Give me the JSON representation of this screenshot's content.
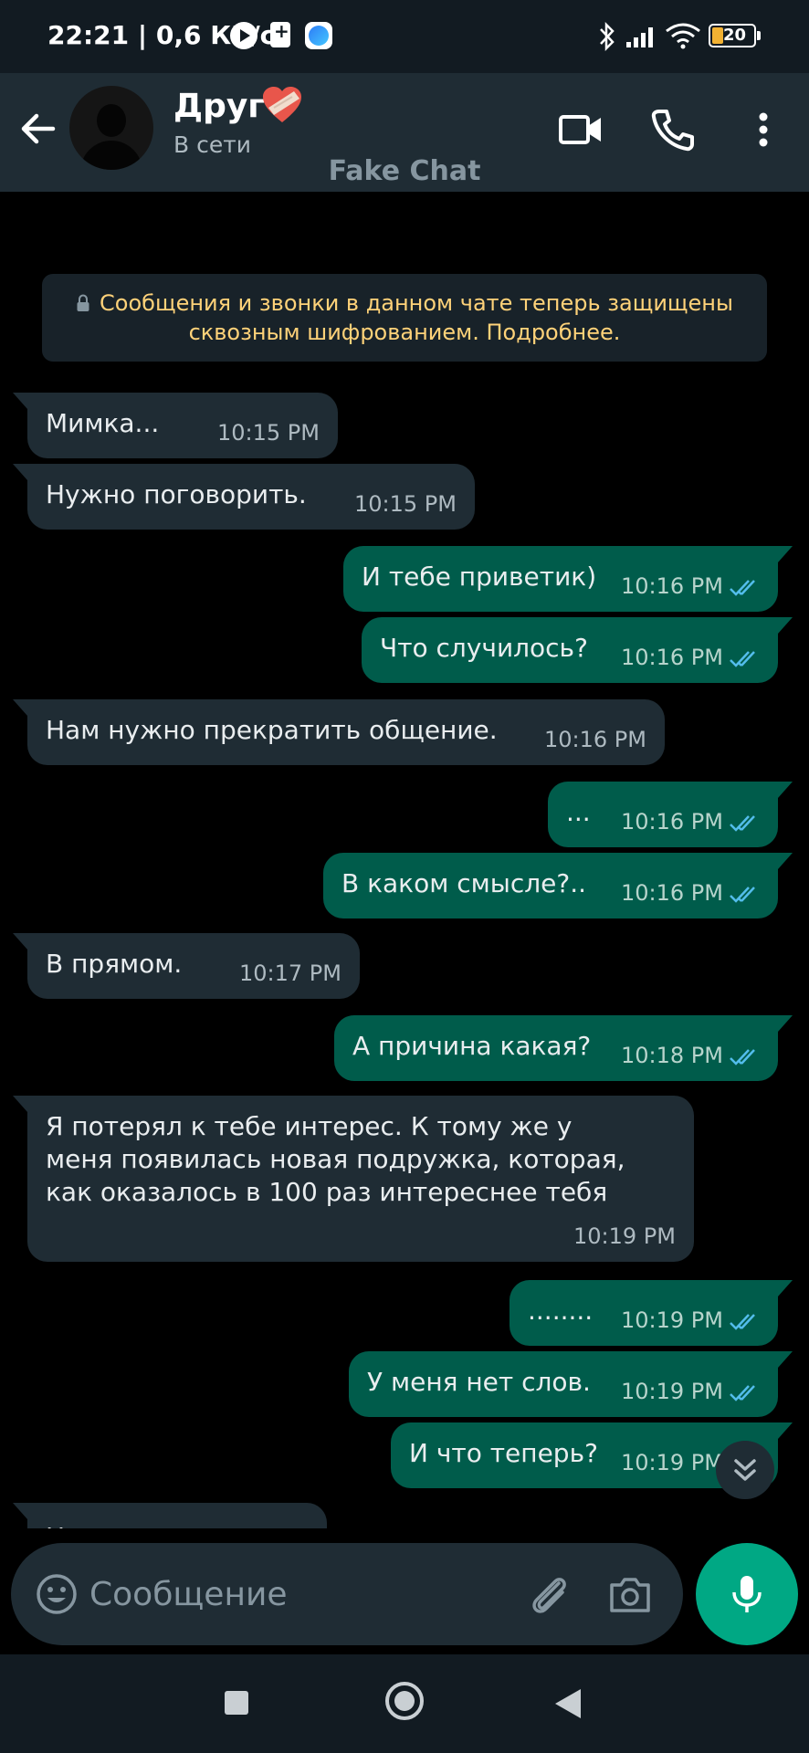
{
  "status_bar": {
    "time": "22:21",
    "speed": "0,6 КБ/с",
    "battery": "20",
    "icons": [
      "play-icon",
      "sim-icon",
      "app-icon",
      "bluetooth-icon",
      "signal-icon",
      "wifi-icon",
      "battery-icon"
    ]
  },
  "header": {
    "contact_name": "Друг",
    "status": "В сети",
    "watermark": "Fake Chat",
    "icons": [
      "back-arrow-icon",
      "video-call-icon",
      "phone-call-icon",
      "more-vert-icon"
    ]
  },
  "notice": {
    "text_line1": "Сообщения и звонки в данном чате теперь защищены",
    "text_line2": "сквозным шифрованием. Подробнее."
  },
  "messages": [
    {
      "dir": "in",
      "text": "Мимка...",
      "time": "10:15 PM"
    },
    {
      "dir": "in",
      "text": "Нужно поговорить.",
      "time": "10:15 PM"
    },
    {
      "dir": "out",
      "text": "И тебе приветик)",
      "time": "10:16 PM"
    },
    {
      "dir": "out",
      "text": "Что случилось?",
      "time": "10:16 PM"
    },
    {
      "dir": "in",
      "text": "Нам нужно прекратить общение.",
      "time": "10:16 PM"
    },
    {
      "dir": "out",
      "text": "...",
      "time": "10:16 PM"
    },
    {
      "dir": "out",
      "text": "В каком смысле?..",
      "time": "10:16 PM"
    },
    {
      "dir": "in",
      "text": "В прямом.",
      "time": "10:17 PM"
    },
    {
      "dir": "out",
      "text": "А причина какая?",
      "time": "10:18 PM"
    },
    {
      "dir": "in",
      "text": "Я потерял к тебе интерес. К тому же у\nменя появилась новая подружка, которая,\nкак оказалось в 100 раз интереснее тебя",
      "time": "10:19 PM"
    },
    {
      "dir": "out",
      "text": "........",
      "time": "10:19 PM"
    },
    {
      "dir": "out",
      "text": "У меня нет слов.",
      "time": "10:19 PM"
    },
    {
      "dir": "out",
      "text": "И что теперь?",
      "time": "10:19 PM"
    },
    {
      "dir": "in",
      "text": "Ничего",
      "time": ""
    }
  ],
  "input": {
    "placeholder": "Сообщение"
  },
  "colors": {
    "incoming_bubble": "#1f2c34",
    "outgoing_bubble": "#005c4b",
    "accent": "#00a884",
    "read_ticks": "#53bdeb",
    "notice_text": "#ffd279"
  }
}
